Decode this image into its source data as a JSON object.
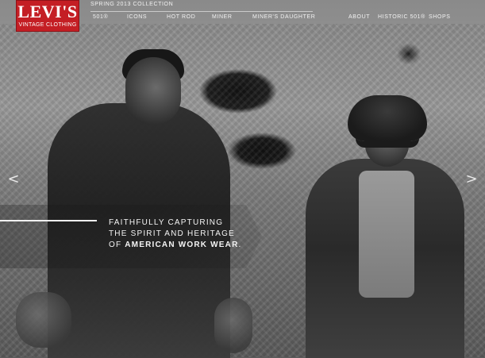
{
  "brand": {
    "logo_text": "LEVI'S",
    "logo_sub": "VINTAGE CLOTHING",
    "brand_color": "#c41e24"
  },
  "header": {
    "collection": "SPRING 2013 COLLECTION"
  },
  "nav": {
    "left_items": [
      "501®",
      "ICONS",
      "HOT ROD",
      "MINER",
      "MINER'S DAUGHTER"
    ],
    "right_items": [
      "ABOUT",
      "HISTORIC 501®",
      "SHOPS"
    ]
  },
  "carousel": {
    "prev_icon": "chevron-left-icon",
    "next_icon": "chevron-right-icon",
    "prev_glyph": "<",
    "next_glyph": ">"
  },
  "tagline": {
    "line1": "FAITHFULLY CAPTURING",
    "line2": "THE SPIRIT AND HERITAGE",
    "line3_prefix": "OF ",
    "line3_bold": "AMERICAN WORK WEAR",
    "line3_suffix": "."
  }
}
